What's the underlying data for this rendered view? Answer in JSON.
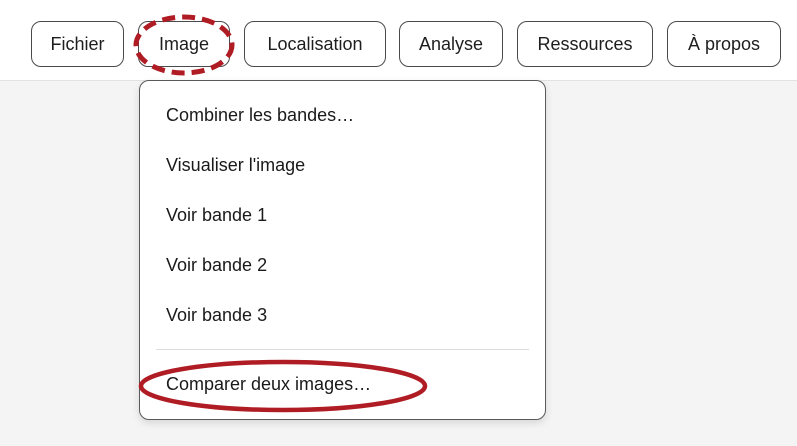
{
  "menubar": {
    "items": [
      {
        "label": "Fichier"
      },
      {
        "label": "Image"
      },
      {
        "label": "Localisation"
      },
      {
        "label": "Analyse"
      },
      {
        "label": "Ressources"
      },
      {
        "label": "À propos"
      }
    ]
  },
  "dropdown": {
    "items": [
      {
        "label": "Combiner les bandes…"
      },
      {
        "label": "Visualiser l'image"
      },
      {
        "label": "Voir bande 1"
      },
      {
        "label": "Voir bande 2"
      },
      {
        "label": "Voir bande 3"
      },
      {
        "label": "Comparer deux images…"
      }
    ]
  },
  "colors": {
    "annotation": "#b01c24",
    "button_border": "#4a4a4a",
    "background": "#f4f4f4"
  }
}
